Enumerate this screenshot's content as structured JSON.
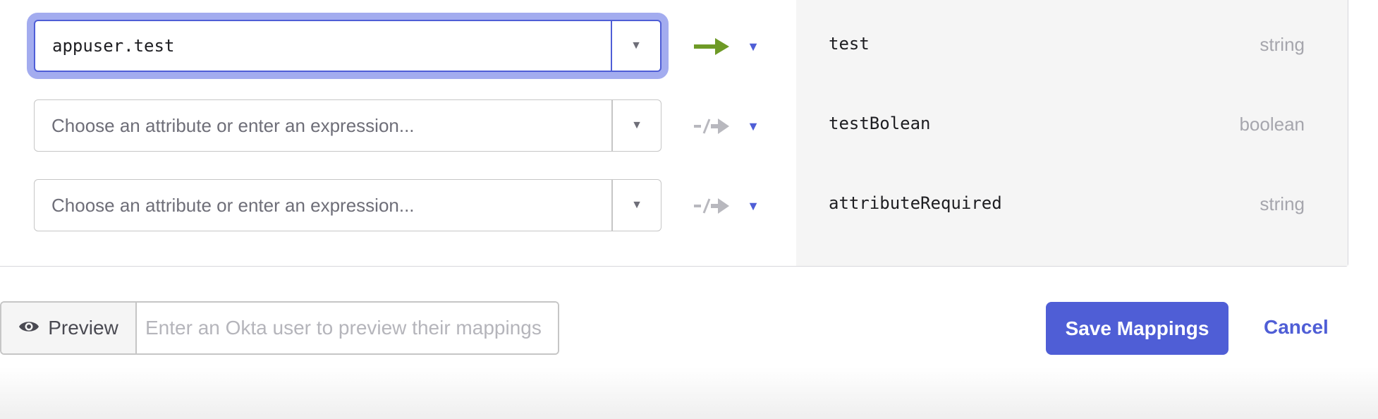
{
  "mappings": [
    {
      "source_value": "appuser.test",
      "source_placeholder": "Choose an attribute or enter an expression...",
      "target_name": "test",
      "target_type": "string",
      "mapped": true
    },
    {
      "source_value": "",
      "source_placeholder": "Choose an attribute or enter an expression...",
      "target_name": "testBolean",
      "target_type": "boolean",
      "mapped": false
    },
    {
      "source_value": "",
      "source_placeholder": "Choose an attribute or enter an expression...",
      "target_name": "attributeRequired",
      "target_type": "string",
      "mapped": false
    }
  ],
  "preview": {
    "button_label": "Preview",
    "input_placeholder": "Enter an Okta user to preview their mappings"
  },
  "actions": {
    "save_label": "Save Mappings",
    "cancel_label": "Cancel"
  },
  "icons": {
    "dropdown": "chevron-down-icon",
    "mapped_arrow": "arrow-right-icon",
    "unmapped_arrow": "no-mapping-arrow-icon",
    "apply_caret": "caret-down-icon",
    "preview": "eye-icon"
  },
  "colors": {
    "accent": "#4f5ed6",
    "focus_ring": "#a3acef",
    "mapped_arrow": "#6e9a26",
    "unmapped_arrow": "#b8b8be",
    "target_bg": "#f5f5f5"
  }
}
